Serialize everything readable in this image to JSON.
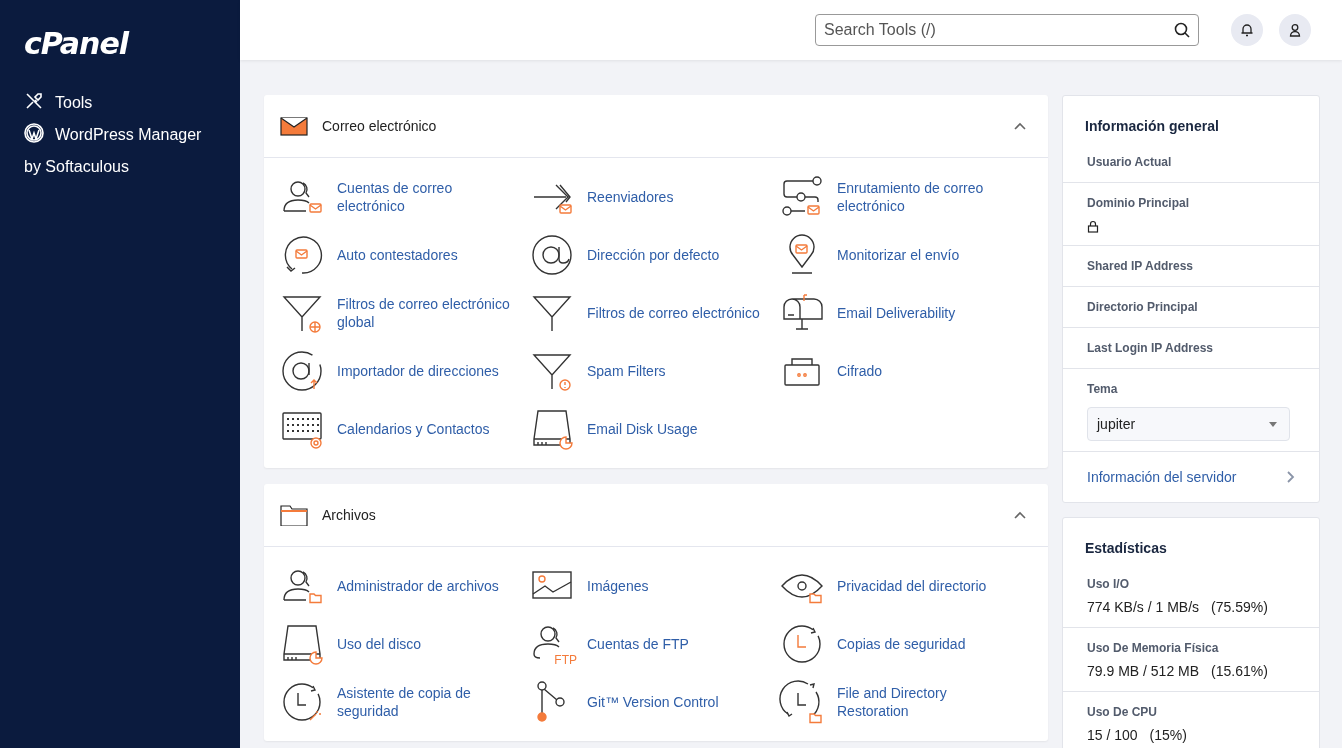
{
  "sidebar": {
    "logo": "cPanel",
    "items": [
      {
        "kind": "tools",
        "label": "Tools"
      },
      {
        "kind": "wordpress",
        "label": "WordPress Manager by Softaculous"
      }
    ]
  },
  "header": {
    "search": {
      "placeholder": "Search Tools (/)"
    }
  },
  "sections": [
    {
      "kind": "mail",
      "title": "Correo electrónico",
      "expanded": true,
      "items": [
        {
          "kind": "user-mail",
          "label": "Cuentas de correo electrónico"
        },
        {
          "kind": "forward",
          "label": "Reenviadores"
        },
        {
          "kind": "routing",
          "label": "Enrutamiento de correo electrónico"
        },
        {
          "kind": "reply",
          "label": "Auto contestadores"
        },
        {
          "kind": "at",
          "label": "Dirección por defecto"
        },
        {
          "kind": "pin",
          "label": "Monitorizar el envío"
        },
        {
          "kind": "filter-globe",
          "label": "Filtros de correo electrónico global"
        },
        {
          "kind": "filter",
          "label": "Filtros de correo electrónico"
        },
        {
          "kind": "mailbox",
          "label": "Email Deliverability"
        },
        {
          "kind": "at-import",
          "label": "Importador de direcciones"
        },
        {
          "kind": "filter-alert",
          "label": "Spam Filters"
        },
        {
          "kind": "case",
          "label": "Cifrado"
        },
        {
          "kind": "calendar",
          "label": "Calendarios y Contactos"
        },
        {
          "kind": "disk",
          "label": "Email Disk Usage"
        }
      ]
    },
    {
      "kind": "folder",
      "title": "Archivos",
      "expanded": true,
      "items": [
        {
          "kind": "user-folder",
          "label": "Administrador de archivos"
        },
        {
          "kind": "image",
          "label": "Imágenes"
        },
        {
          "kind": "eye",
          "label": "Privacidad del directorio"
        },
        {
          "kind": "disk",
          "label": "Uso del disco"
        },
        {
          "kind": "ftp",
          "label": "Cuentas de FTP",
          "caption": "FTP"
        },
        {
          "kind": "backup",
          "label": "Copias de seguridad"
        },
        {
          "kind": "backup-wizard",
          "label": "Asistente de copia de seguridad"
        },
        {
          "kind": "git",
          "label": "Git™ Version Control"
        },
        {
          "kind": "restore",
          "label": "File and Directory Restoration"
        }
      ]
    }
  ],
  "general_info": {
    "title": "Información general",
    "rows": [
      {
        "kind": "field",
        "label": "Usuario Actual"
      },
      {
        "kind": "lock",
        "label": "Dominio Principal"
      },
      {
        "kind": "field",
        "label": "Shared IP Address"
      },
      {
        "kind": "field",
        "label": "Directorio Principal"
      },
      {
        "kind": "field",
        "label": "Last Login IP Address"
      },
      {
        "kind": "select",
        "label": "Tema",
        "value": "jupiter"
      },
      {
        "kind": "link",
        "label": "Información del servidor"
      }
    ]
  },
  "statistics": {
    "title": "Estadísticas",
    "rows": [
      {
        "label": "Uso I/O",
        "value": "774 KB/s / 1 MB/s",
        "percent": "(75.59%)"
      },
      {
        "label": "Uso De Memoria Física",
        "value": "79.9 MB / 512 MB",
        "percent": "(15.61%)"
      },
      {
        "label": "Uso De CPU",
        "value": "15 / 100",
        "percent": "(15%)"
      }
    ]
  }
}
